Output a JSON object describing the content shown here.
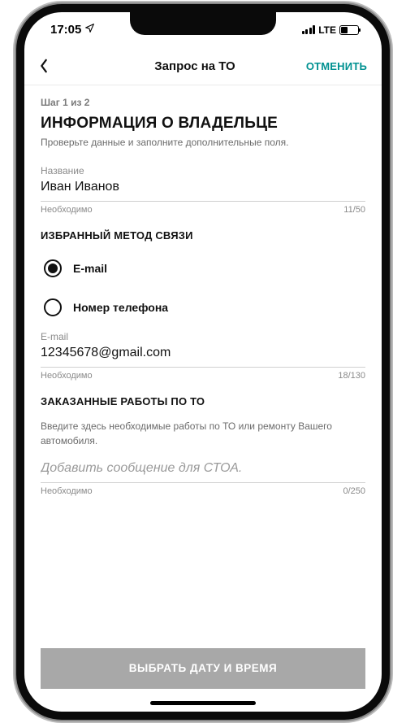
{
  "status": {
    "time": "17:05",
    "network": "LTE"
  },
  "nav": {
    "title": "Запрос на ТО",
    "cancel": "ОТМЕНИТЬ"
  },
  "step": "Шаг 1 из 2",
  "owner": {
    "heading": "ИНФОРМАЦИЯ О ВЛАДЕЛЬЦЕ",
    "subtitle": "Проверьте данные и заполните дополнительные поля."
  },
  "name_field": {
    "label": "Название",
    "value": "Иван Иванов",
    "hint": "Необходимо",
    "counter": "11/50"
  },
  "contact": {
    "heading": "ИЗБРАННЫЙ МЕТОД СВЯЗИ",
    "options": {
      "email": "E-mail",
      "phone": "Номер телефона"
    }
  },
  "email_field": {
    "label": "E-mail",
    "value": "12345678@gmail.com",
    "hint": "Необходимо",
    "counter": "18/130"
  },
  "work": {
    "heading": "ЗАКАЗАННЫЕ РАБОТЫ ПО ТО",
    "desc": "Введите здесь необходимые работы по ТО или ремонту Вашего автомобиля.",
    "placeholder": "Добавить сообщение для СТОА.",
    "hint": "Необходимо",
    "counter": "0/250"
  },
  "footer": {
    "button": "ВЫБРАТЬ ДАТУ И ВРЕМЯ"
  }
}
